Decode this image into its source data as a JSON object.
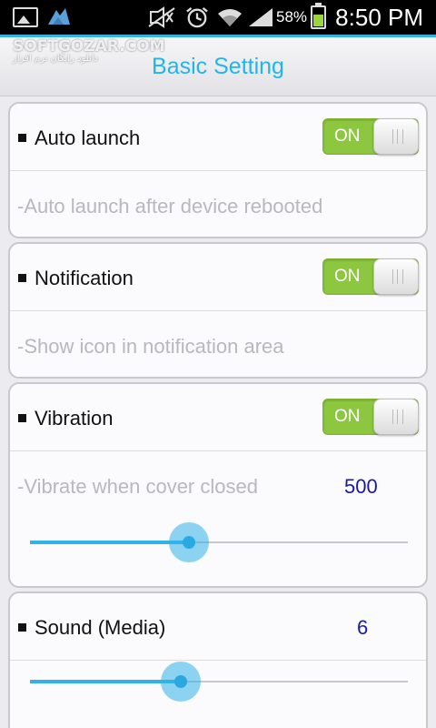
{
  "status_bar": {
    "battery_percent": "58%",
    "battery_level": 0.58,
    "time": "8:50 PM",
    "icons": [
      "picture-icon",
      "app-notification-icon",
      "mute-icon",
      "alarm-icon",
      "wifi-icon",
      "signal-icon",
      "battery-icon"
    ]
  },
  "watermark": {
    "brand": "SOFTGOZAR.COM",
    "subtitle": "دانلود رایگان نرم افزار"
  },
  "header": {
    "title": "Basic Setting"
  },
  "settings": {
    "auto_launch": {
      "title": "Auto launch",
      "toggle": "ON",
      "description": "-Auto launch after device rebooted"
    },
    "notification": {
      "title": "Notification",
      "toggle": "ON",
      "description": "-Show icon in notification area"
    },
    "vibration": {
      "title": "Vibration",
      "toggle": "ON",
      "description": "-Vibrate when cover closed",
      "value": "500",
      "slider_fraction": 0.42
    },
    "sound": {
      "title": "Sound (Media)",
      "value": "6",
      "slider_fraction": 0.4
    }
  },
  "colors": {
    "accent": "#31b2e8",
    "toggle_on": "#8dc63f",
    "value_text": "#1a1aa0",
    "description_text": "#b8b8bd"
  }
}
